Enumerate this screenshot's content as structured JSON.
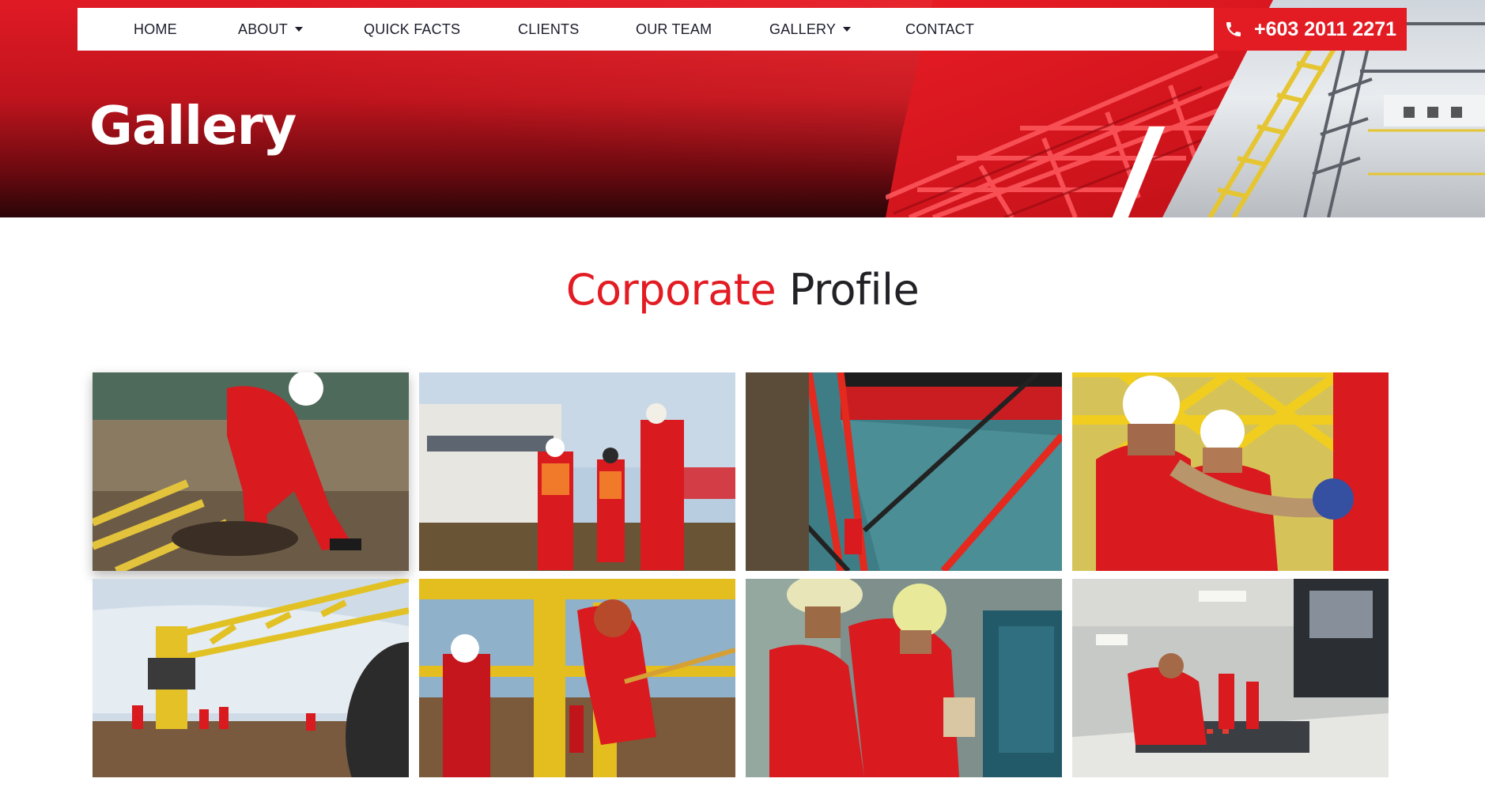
{
  "nav": {
    "items": [
      {
        "label": "HOME",
        "has_dropdown": false
      },
      {
        "label": "ABOUT",
        "has_dropdown": true
      },
      {
        "label": "QUICK FACTS",
        "has_dropdown": false
      },
      {
        "label": "CLIENTS",
        "has_dropdown": false
      },
      {
        "label": "OUR TEAM",
        "has_dropdown": false
      },
      {
        "label": "GALLERY",
        "has_dropdown": true
      },
      {
        "label": "CONTACT",
        "has_dropdown": false
      }
    ],
    "phone": "+603 2011 2271",
    "phone_icon": "phone-icon"
  },
  "hero": {
    "title": "Gallery"
  },
  "section": {
    "title_accent": "Corporate",
    "title_rest": "Profile"
  },
  "gallery": {
    "photos": [
      {
        "id": "photo-rope-handling",
        "icon": "image-icon"
      },
      {
        "id": "photo-crew-on-deck",
        "icon": "image-icon"
      },
      {
        "id": "photo-ship-side-ladder",
        "icon": "image-icon"
      },
      {
        "id": "photo-workers-hauling-rope",
        "icon": "image-icon"
      },
      {
        "id": "photo-deck-crane",
        "icon": "image-icon"
      },
      {
        "id": "photo-welder-on-platform",
        "icon": "image-icon"
      },
      {
        "id": "photo-technicians-at-pump",
        "icon": "image-icon"
      },
      {
        "id": "photo-control-room",
        "icon": "image-icon"
      }
    ]
  },
  "colors": {
    "brand_red": "#e31b23",
    "text_dark": "#1d1d2c",
    "hero_dark": "#2a0507"
  }
}
